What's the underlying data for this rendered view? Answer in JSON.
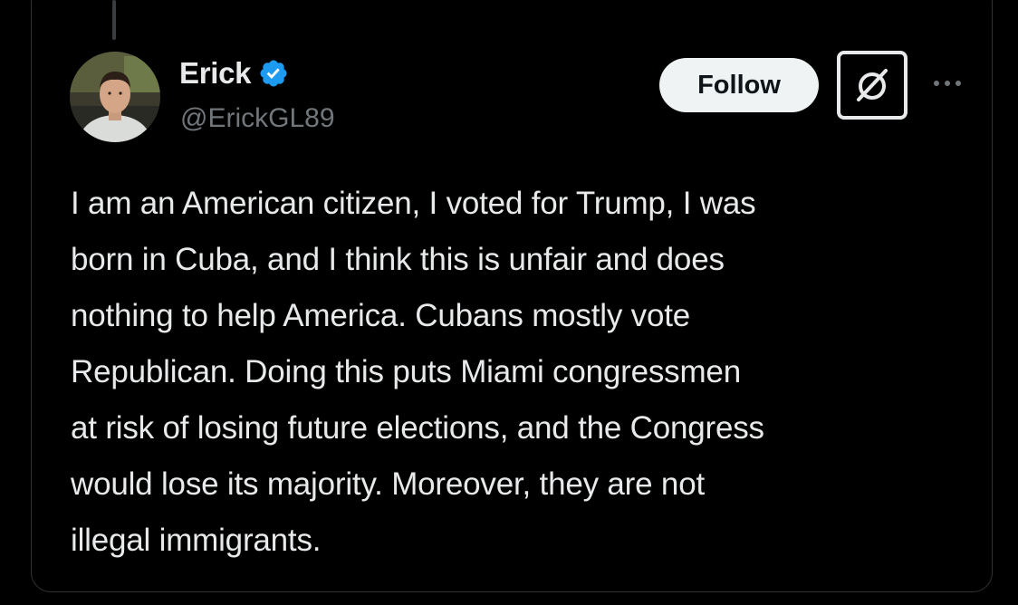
{
  "author": {
    "display_name": "Erick",
    "handle": "@ErickGL89",
    "verified": true
  },
  "actions": {
    "follow_label": "Follow"
  },
  "icons": {
    "verified": "verified-badge-icon",
    "grok": "grok-icon",
    "more": "more-icon"
  },
  "colors": {
    "background": "#000000",
    "text_primary": "#e7e9ea",
    "text_secondary": "#71767b",
    "verified_blue": "#1d9bf0",
    "follow_bg": "#eff3f4"
  },
  "tweet": {
    "text": "I am an American citizen, I voted for Trump, I was\nborn in Cuba, and I think this is unfair and does\nnothing to help America. Cubans mostly vote\nRepublican. Doing this puts Miami congressmen\nat risk of losing future elections, and the Congress\nwould lose its majority. Moreover, they are not\nillegal immigrants."
  }
}
